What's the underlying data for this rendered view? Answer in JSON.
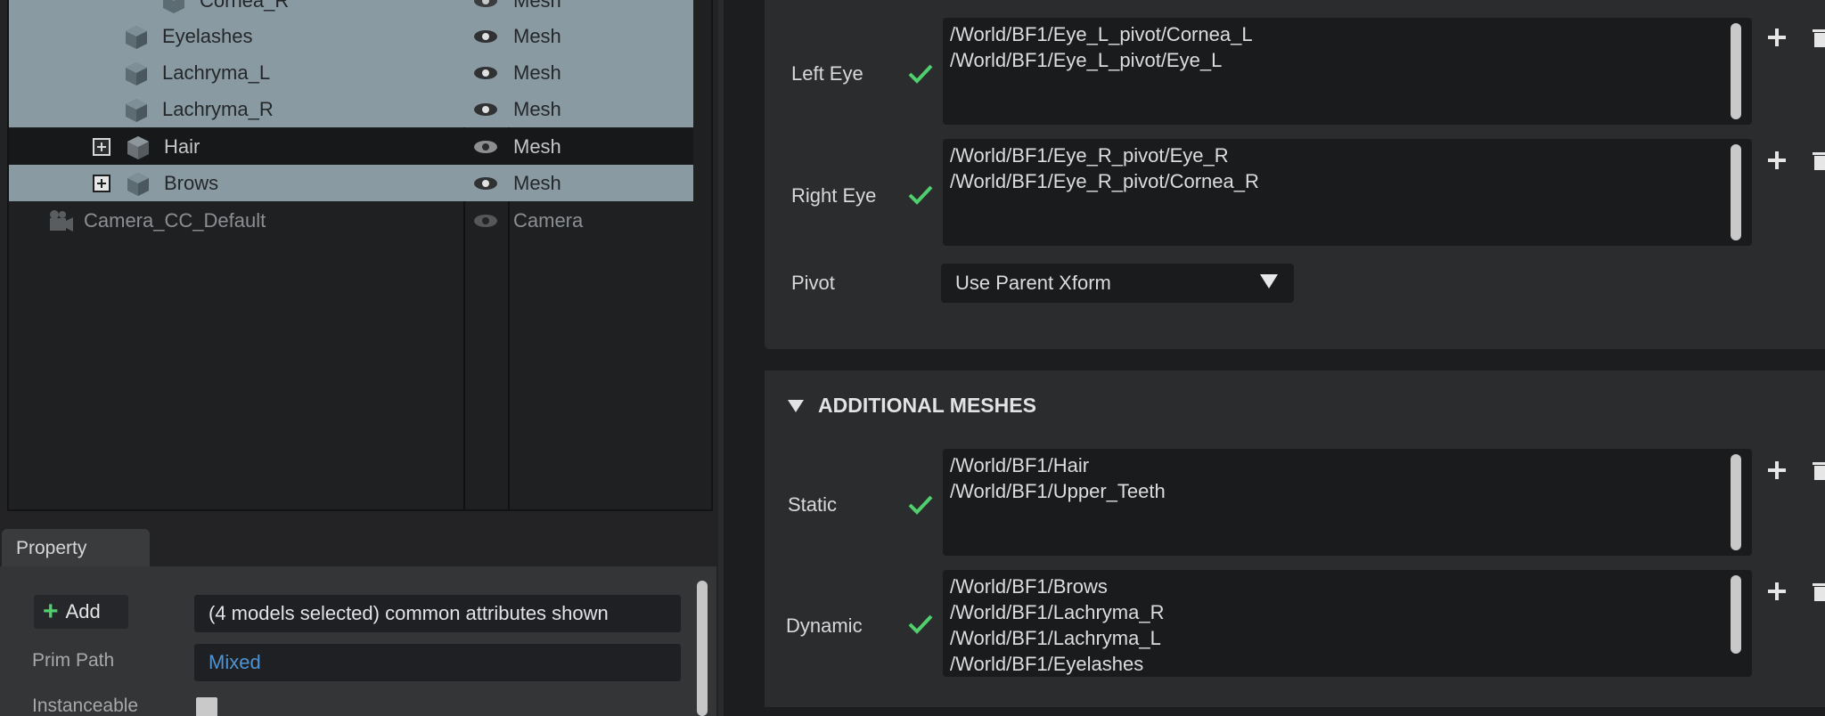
{
  "stage": {
    "rows": [
      {
        "name": "Cornea_R",
        "type": "Mesh",
        "state": "partial"
      },
      {
        "name": "Eyelashes",
        "type": "Mesh",
        "state": "selected"
      },
      {
        "name": "Lachryma_L",
        "type": "Mesh",
        "state": "selected"
      },
      {
        "name": "Lachryma_R",
        "type": "Mesh",
        "state": "selected"
      },
      {
        "name": "Hair",
        "type": "Mesh",
        "state": "dark"
      },
      {
        "name": "Brows",
        "type": "Mesh",
        "state": "selected"
      },
      {
        "name": "Camera_CC_Default",
        "type": "Camera",
        "state": "normal"
      }
    ]
  },
  "property": {
    "tab_label": "Property",
    "add_label": "Add",
    "info_text": "(4 models selected) common attributes shown",
    "prim_path_label": "Prim Path",
    "prim_path_value": "Mixed",
    "instanceable_label": "Instanceable"
  },
  "eyes": {
    "left_eye_label": "Left Eye",
    "left_eye_paths": [
      "/World/BF1/Eye_L_pivot/Cornea_L",
      "/World/BF1/Eye_L_pivot/Eye_L"
    ],
    "right_eye_label": "Right Eye",
    "right_eye_paths": [
      "/World/BF1/Eye_R_pivot/Eye_R",
      "/World/BF1/Eye_R_pivot/Cornea_R"
    ],
    "pivot_label": "Pivot",
    "pivot_value": "Use Parent Xform"
  },
  "additional_meshes": {
    "title": "ADDITIONAL MESHES",
    "static_label": "Static",
    "static_paths": [
      "/World/BF1/Hair",
      "/World/BF1/Upper_Teeth"
    ],
    "dynamic_label": "Dynamic",
    "dynamic_paths": [
      "/World/BF1/Brows",
      "/World/BF1/Lachryma_R",
      "/World/BF1/Lachryma_L",
      "/World/BF1/Eyelashes"
    ]
  },
  "colors": {
    "selection": "#8a9aa3",
    "check_green": "#4fd06d",
    "link_blue": "#4e93d4"
  }
}
